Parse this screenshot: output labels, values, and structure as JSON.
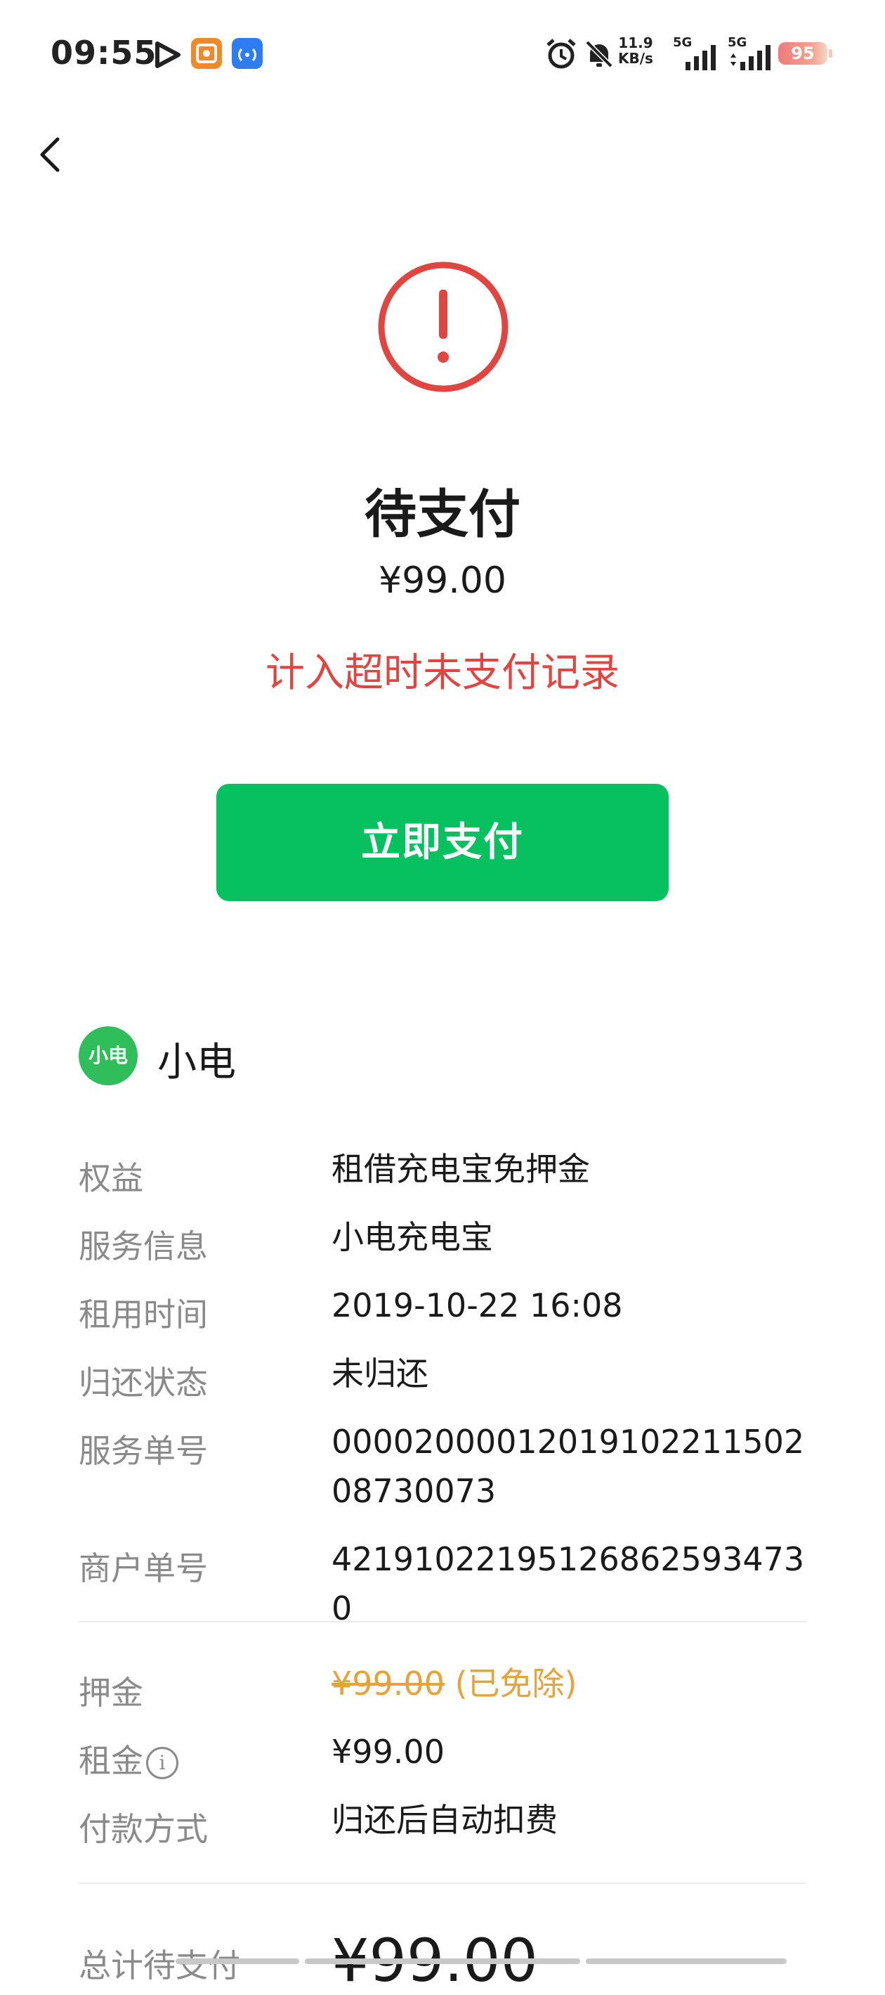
{
  "status_bar": {
    "time": "09:55",
    "net_speed_value": "11.9",
    "net_speed_unit": "KB/s",
    "sim1_label": "5G",
    "sim2_label": "5G",
    "battery": "95",
    "icons": [
      "play-icon",
      "app-notification-icon",
      "nfc-icon",
      "alarm-icon",
      "mute-icon",
      "signal-icon",
      "signal-icon",
      "battery-icon"
    ]
  },
  "header": {
    "back_icon": "chevron-left-icon"
  },
  "order": {
    "status_icon": "exclamation-circle-icon",
    "status_title": "待支付",
    "amount": "¥99.00",
    "warning": "计入超时未支付记录",
    "pay_button": "立即支付"
  },
  "merchant": {
    "logo_text": "小电",
    "name": "小电"
  },
  "details": [
    {
      "label": "权益",
      "value": "租借充电宝免押金"
    },
    {
      "label": "服务信息",
      "value": "小电充电宝"
    },
    {
      "label": "租用时间",
      "value": "2019-10-22 16:08"
    },
    {
      "label": "归还状态",
      "value": "未归还"
    },
    {
      "label": "服务单号",
      "value": "00002000012019102211502087300​73"
    },
    {
      "label": "商户单号",
      "value": "4219102219512686259347​30"
    }
  ],
  "fees": {
    "deposit_label": "押金",
    "deposit_original": "¥99.00",
    "deposit_note": "(已免除)",
    "rent_label": "租金",
    "rent_value": "¥99.00",
    "payment_label": "付款方式",
    "payment_value": "归还后自动扣费"
  },
  "total": {
    "label": "总计待支付",
    "amount": "¥99.00"
  },
  "colors": {
    "accent_green": "#07c160",
    "warning_red": "#e0453f",
    "waived_orange": "#e8a23a"
  }
}
